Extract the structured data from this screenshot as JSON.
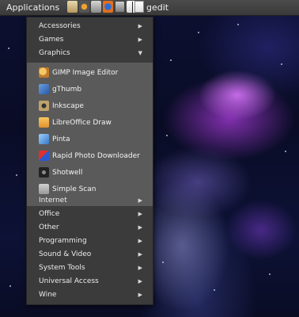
{
  "panel": {
    "applications_label": "Applications",
    "launchers": [
      "gimp-launcher-icon",
      "system-monitor-icon",
      "files-icon",
      "firefox-icon",
      "terminal-icon",
      "text-editor-icon"
    ],
    "window_title": "gedit"
  },
  "menu": {
    "items_top": [
      {
        "label": "Accessories",
        "arrow": "▶"
      },
      {
        "label": "Games",
        "arrow": "▶"
      },
      {
        "label": "Graphics",
        "arrow": "▼"
      }
    ],
    "graphics_items": [
      {
        "label": "GIMP Image Editor",
        "icon": "gimp-icon"
      },
      {
        "label": "gThumb",
        "icon": "gthumb-icon"
      },
      {
        "label": "Inkscape",
        "icon": "inkscape-icon"
      },
      {
        "label": "LibreOffice Draw",
        "icon": "libreoffice-draw-icon"
      },
      {
        "label": "Pinta",
        "icon": "pinta-icon"
      },
      {
        "label": "Rapid Photo Downloader",
        "icon": "rapid-photo-downloader-icon"
      },
      {
        "label": "Shotwell",
        "icon": "shotwell-icon"
      },
      {
        "label": "Simple Scan",
        "icon": "simple-scan-icon"
      }
    ],
    "items_bottom": [
      {
        "label": "Internet",
        "arrow": "▶"
      },
      {
        "label": "Office",
        "arrow": "▶"
      },
      {
        "label": "Other",
        "arrow": "▶"
      },
      {
        "label": "Programming",
        "arrow": "▶"
      },
      {
        "label": "Sound & Video",
        "arrow": "▶"
      },
      {
        "label": "System Tools",
        "arrow": "▶"
      },
      {
        "label": "Universal Access",
        "arrow": "▶"
      },
      {
        "label": "Wine",
        "arrow": "▶"
      }
    ]
  },
  "colors": {
    "panel_bg": "#3f3f3f",
    "menu_bg": "#3b3b3b",
    "submenu_bg": "#5a5a5a",
    "text": "#ececec"
  }
}
